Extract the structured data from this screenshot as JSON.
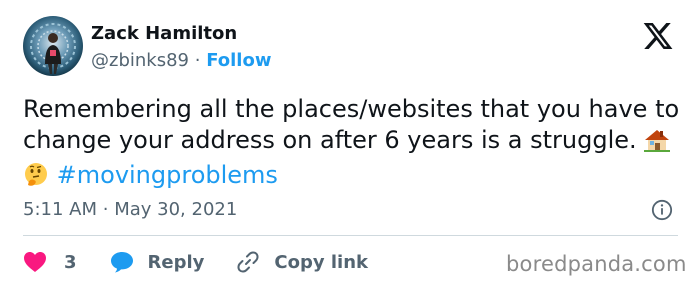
{
  "author": {
    "name": "Zack Hamilton",
    "handle": "@zbinks89",
    "separator": "·",
    "follow_label": "Follow"
  },
  "tweet": {
    "text_main": "Remembering all the places/websites that you have to change your address on after 6 years is a struggle.",
    "emoji_1": "house-emoji",
    "emoji_2": "thinking-face-emoji",
    "hashtag": "#movingproblems"
  },
  "meta": {
    "time": "5:11 AM",
    "separator": "·",
    "date": "May 30, 2021"
  },
  "actions": {
    "like_count": "3",
    "reply_label": "Reply",
    "copy_link_label": "Copy link"
  },
  "watermark": "boredpanda.com",
  "colors": {
    "text": "#0f1419",
    "secondary": "#536471",
    "accent": "#1d9bf0",
    "like": "#f91880",
    "divider": "#cfd9de"
  }
}
